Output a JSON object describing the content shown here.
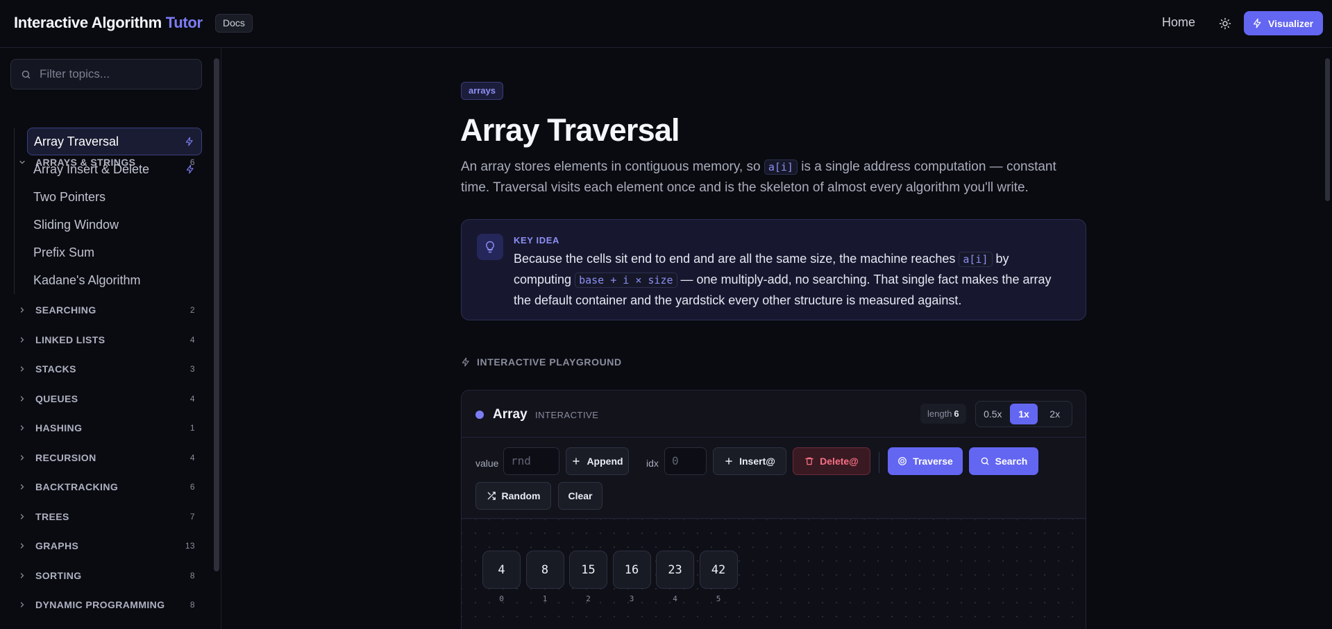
{
  "header": {
    "brand_main": "Interactive Algorithm",
    "brand_accent": "Tutor",
    "docs_label": "Docs",
    "home_label": "Home",
    "visualizer_label": "Visualizer"
  },
  "sidebar": {
    "filter_placeholder": "Filter topics...",
    "open_category": {
      "label": "ARRAYS & STRINGS",
      "count": "6",
      "topics": [
        {
          "label": "Array Traversal",
          "active": true,
          "interactive": true
        },
        {
          "label": "Array Insert & Delete",
          "active": false,
          "interactive": true
        },
        {
          "label": "Two Pointers",
          "active": false,
          "interactive": false
        },
        {
          "label": "Sliding Window",
          "active": false,
          "interactive": false
        },
        {
          "label": "Prefix Sum",
          "active": false,
          "interactive": false
        },
        {
          "label": "Kadane's Algorithm",
          "active": false,
          "interactive": false
        }
      ]
    },
    "categories": [
      {
        "label": "SEARCHING",
        "count": "2"
      },
      {
        "label": "LINKED LISTS",
        "count": "4"
      },
      {
        "label": "STACKS",
        "count": "3"
      },
      {
        "label": "QUEUES",
        "count": "4"
      },
      {
        "label": "HASHING",
        "count": "1"
      },
      {
        "label": "RECURSION",
        "count": "4"
      },
      {
        "label": "BACKTRACKING",
        "count": "6"
      },
      {
        "label": "TREES",
        "count": "7"
      },
      {
        "label": "GRAPHS",
        "count": "13"
      },
      {
        "label": "SORTING",
        "count": "8"
      },
      {
        "label": "DYNAMIC PROGRAMMING",
        "count": "8"
      }
    ]
  },
  "main": {
    "tag": "arrays",
    "title": "Array Traversal",
    "intro": {
      "part1": "An array stores elements in contiguous memory, so ",
      "code1": "a[i]",
      "part2": " is a single address computation — constant time. Traversal visits each element once and is the skeleton of almost every algorithm you'll write."
    },
    "key_idea": {
      "label": "KEY IDEA",
      "part1": "Because the cells sit end to end and are all the same size, the machine reaches ",
      "code1": "a[i]",
      "part2": " by computing ",
      "code2": "base + i × size",
      "part3": " — one multiply-add, no searching. That single fact makes the array the default container and the yardstick every other structure is measured against."
    },
    "playground_label": "INTERACTIVE PLAYGROUND"
  },
  "panel": {
    "title": "Array",
    "kind": "INTERACTIVE",
    "length_label": "length",
    "length_value": "6",
    "speeds": [
      "0.5x",
      "1x",
      "2x"
    ],
    "active_speed": "1x",
    "controls": {
      "value_label": "value",
      "value_placeholder": "rnd",
      "append": "Append",
      "idx_label": "idx",
      "idx_placeholder": "0",
      "insert": "Insert@",
      "delete": "Delete@",
      "traverse": "Traverse",
      "search": "Search",
      "random": "Random",
      "clear": "Clear"
    },
    "array": {
      "values": [
        "4",
        "8",
        "15",
        "16",
        "23",
        "42"
      ],
      "indices": [
        "0",
        "1",
        "2",
        "3",
        "4",
        "5"
      ]
    }
  },
  "colors": {
    "accent": "#6366f1",
    "accent_text": "#7c7cf5",
    "danger": "#f87185",
    "background": "#0a0b10"
  }
}
